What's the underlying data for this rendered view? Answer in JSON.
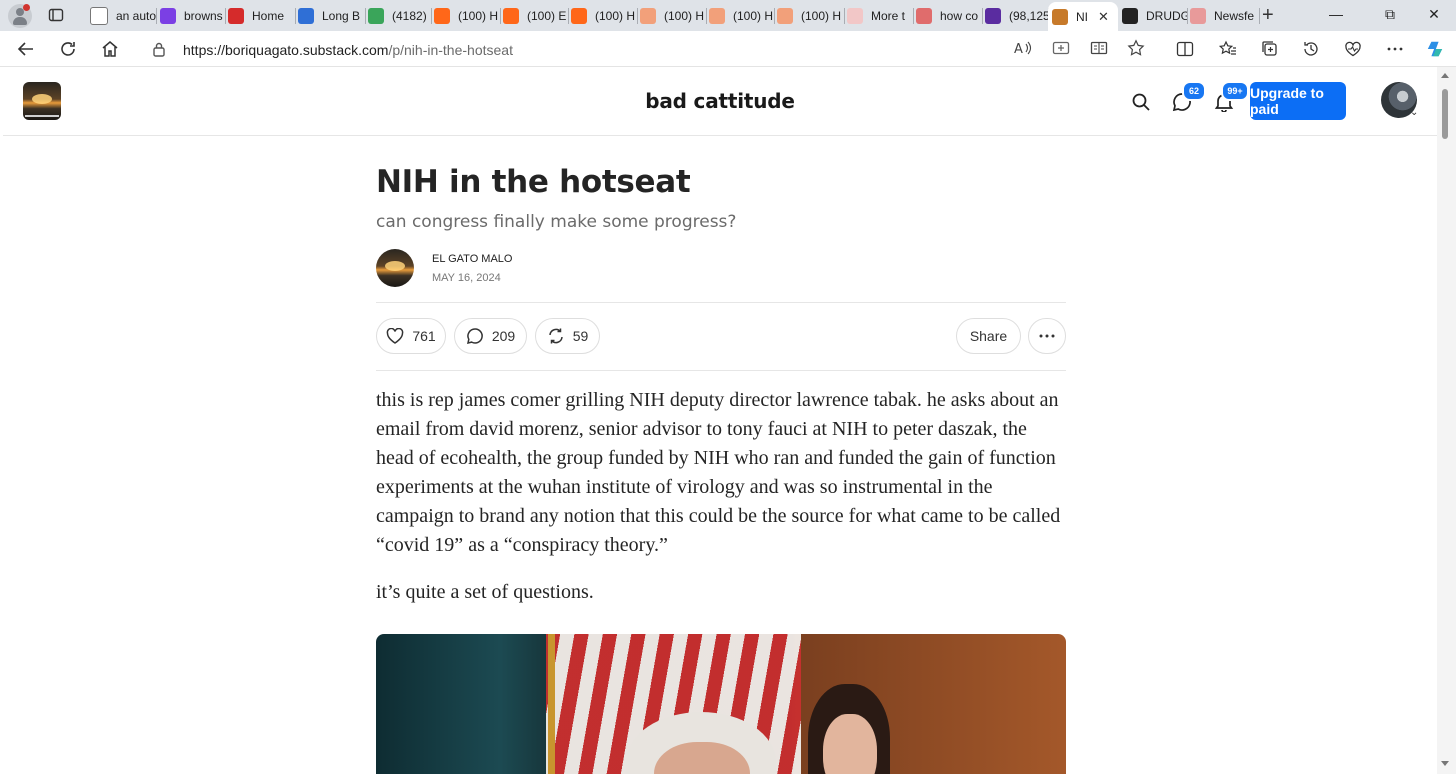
{
  "browser": {
    "tabs": [
      {
        "label": "an auto",
        "color": "#ffffff",
        "icon": "document-icon"
      },
      {
        "label": "browns",
        "color": "#7b3fe4",
        "icon": "yahoo-icon"
      },
      {
        "label": "Home",
        "color": "#d52b2b",
        "icon": "home-icon"
      },
      {
        "label": "Long B",
        "color": "#2f6fd6",
        "icon": "five-icon"
      },
      {
        "label": "(4182)",
        "color": "#3aa55a",
        "icon": "g-icon"
      },
      {
        "label": "(100) H",
        "color": "#ff6719",
        "icon": "substack-icon"
      },
      {
        "label": "(100) E",
        "color": "#ff6719",
        "icon": "substack-icon"
      },
      {
        "label": "(100) H",
        "color": "#ff6719",
        "icon": "substack-icon"
      },
      {
        "label": "(100) H",
        "color": "#f2a07a",
        "icon": "substack-icon"
      },
      {
        "label": "(100) H",
        "color": "#f2a07a",
        "icon": "substack-icon"
      },
      {
        "label": "(100) H",
        "color": "#f2a07a",
        "icon": "substack-icon"
      },
      {
        "label": "More t",
        "color": "#f2c7c7",
        "icon": "bi-icon"
      },
      {
        "label": "how co",
        "color": "#e06c6c",
        "icon": "youtube-icon"
      },
      {
        "label": "(98,125",
        "color": "#5a2ca0",
        "icon": "mail-icon"
      },
      {
        "label": "NI",
        "color": "#c77a2a",
        "icon": "site-icon",
        "active": true
      },
      {
        "label": "DRUDG",
        "color": "#222222",
        "icon": "drudge-icon"
      },
      {
        "label": "Newsfe",
        "color": "#e89a9a",
        "icon": "f-icon"
      }
    ],
    "url_host": "https://boriquagato.substack.com",
    "url_path": "/p/nih-in-the-hotseat"
  },
  "site": {
    "title": "bad cattitude",
    "chat_badge": "62",
    "notif_badge": "99+",
    "upgrade_label": "Upgrade to paid"
  },
  "article": {
    "title": "NIH in the hotseat",
    "subtitle": "can congress finally make some progress?",
    "author": "EL GATO MALO",
    "date": "MAY 16, 2024",
    "likes": "761",
    "comments": "209",
    "restacks": "59",
    "share_label": "Share",
    "paragraphs": [
      "this is rep james comer grilling NIH deputy director lawrence tabak. he asks about an email from david morenz, senior advisor to tony fauci at NIH to peter daszak, the head of ecohealth, the group funded by NIH who ran and funded the gain of function experiments at the wuhan institute of virology and was so instrumental in the campaign to brand any notion that this could be the source for what came to be called “covid 19” as a “conspiracy theory.”",
      "it’s quite a set of questions."
    ]
  }
}
